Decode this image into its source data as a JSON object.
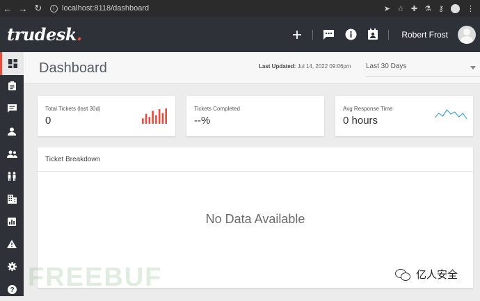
{
  "browser": {
    "url": "localhost:8118/dashboard"
  },
  "topbar": {
    "logo": "trudesk",
    "logo_dot": ".",
    "user_name": "Robert Frost"
  },
  "header": {
    "title": "Dashboard",
    "last_updated_label": "Last Updated:",
    "last_updated_value": "Jul 14, 2022 09:06pm",
    "range_selected": "Last 30 Days"
  },
  "cards": [
    {
      "label": "Total Tickets (last 30d)",
      "value": "0",
      "spark_type": "bars",
      "spark_color": "#e74c3c",
      "spark_values": [
        0.35,
        0.65,
        0.45,
        0.85,
        0.55,
        0.95,
        0.7,
        1.0
      ]
    },
    {
      "label": "Tickets Completed",
      "value": "--%"
    },
    {
      "label": "Avg Response Time",
      "value": "0 hours",
      "spark_type": "line",
      "spark_color": "#3fa9d6",
      "spark_values": [
        0.3,
        0.6,
        0.4,
        0.85,
        0.55,
        0.7,
        0.35,
        0.6,
        0.2
      ]
    }
  ],
  "breakdown": {
    "title": "Ticket Breakdown",
    "empty_text": "No Data Available"
  },
  "sidebar_icons": [
    "dashboard-icon",
    "tickets-icon",
    "messages-icon",
    "account-icon",
    "customers-icon",
    "teams-icon",
    "departments-icon",
    "reports-icon",
    "notices-icon",
    "settings-icon",
    "help-icon"
  ],
  "overlay": {
    "watermark": "FREEBUF",
    "wechat_label": "亿人安全"
  }
}
